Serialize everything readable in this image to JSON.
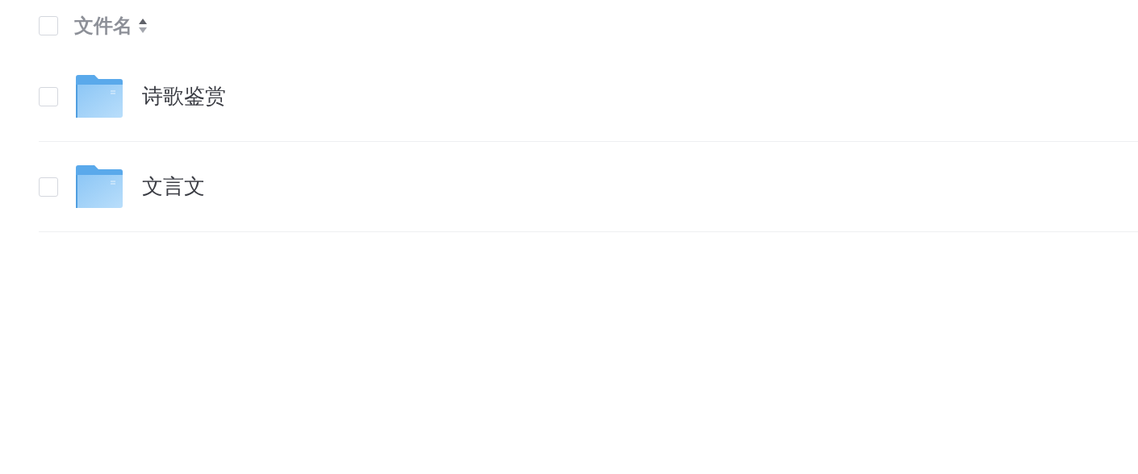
{
  "header": {
    "checked": false,
    "column": "文件名"
  },
  "rows": [
    {
      "name": "诗歌鉴赏",
      "checked": false
    },
    {
      "name": "文言文",
      "checked": false
    }
  ]
}
